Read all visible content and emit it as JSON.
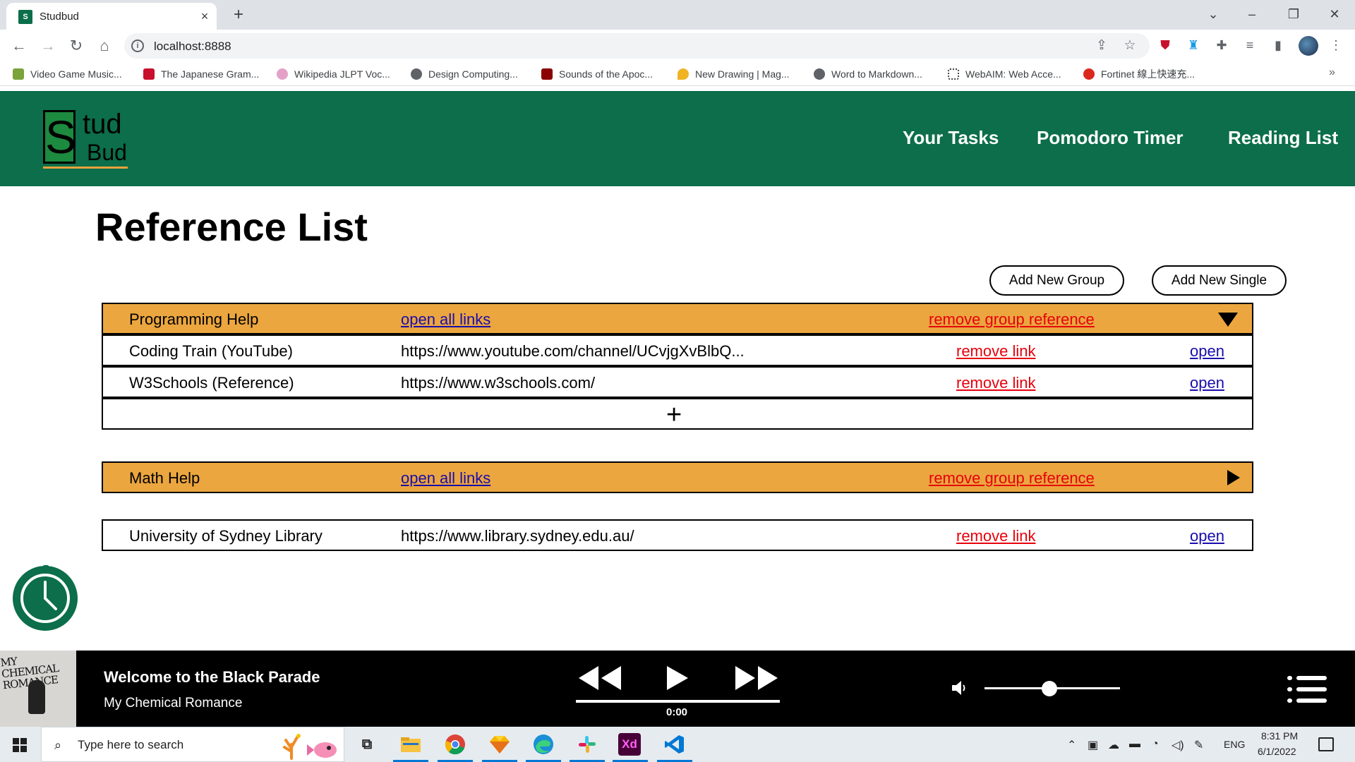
{
  "browser": {
    "tab_title": "Studbud",
    "tab_close_icon": "×",
    "new_tab_icon": "+",
    "url": "localhost:8888",
    "bookmarks": [
      {
        "label": "Video Game Music...",
        "color": "#7aa33a"
      },
      {
        "label": "The Japanese Gram...",
        "color": "#c8102e"
      },
      {
        "label": "Wikipedia JLPT Voc...",
        "color": "#e4a1c8"
      },
      {
        "label": "Design Computing...",
        "color": "#5f6368"
      },
      {
        "label": "Sounds of the Apoc...",
        "color": "#8b0000"
      },
      {
        "label": "New Drawing | Mag...",
        "color": "#f0b323"
      },
      {
        "label": "Word to Markdown...",
        "color": "#5f6368"
      },
      {
        "label": "WebAIM: Web Acce...",
        "color": "#444444"
      },
      {
        "label": "Fortinet 線上快速充...",
        "color": "#da291c"
      }
    ],
    "bookmarks_more": "»"
  },
  "site": {
    "logo": {
      "s": "S",
      "tud": "tud",
      "bud": "Bud"
    },
    "nav": [
      "Your Tasks",
      "Pomodoro Timer",
      "Reading List"
    ],
    "colors": {
      "header": "#0c6e4b",
      "group_row": "#eba63f",
      "remove": "#e8000b",
      "link": "#1a0dab"
    }
  },
  "main": {
    "title": "Reference List",
    "add_group_label": "Add New Group",
    "add_single_label": "Add New Single",
    "groups": [
      {
        "name": "Programming Help",
        "open_all": "open all links",
        "remove_group": "remove group reference",
        "expanded": true,
        "items": [
          {
            "name": "Coding Train (YouTube)",
            "url": "https://www.youtube.com/channel/UCvjgXvBlbQ...",
            "remove": "remove link",
            "open": "open"
          },
          {
            "name": "W3Schools (Reference)",
            "url": "https://www.w3schools.com/",
            "remove": "remove link",
            "open": "open"
          }
        ],
        "add_icon": "+"
      },
      {
        "name": "Math Help",
        "open_all": "open all links",
        "remove_group": "remove group reference",
        "expanded": false
      }
    ],
    "singles": [
      {
        "name": "University of Sydney Library",
        "url": "https://www.library.sydney.edu.au/",
        "remove": "remove link",
        "open": "open"
      }
    ]
  },
  "player": {
    "album_text": "MY CHEMICAL ROMANCE",
    "song": "Welcome to the Black Parade",
    "artist": "My Chemical Romance",
    "rewind_icon": "◀◀",
    "play_icon": "▶",
    "forward_icon": "▶▶",
    "time": "0:00",
    "volume_fraction": 0.48
  },
  "taskbar": {
    "search_placeholder": "Type here to search",
    "language": "ENG",
    "time": "8:31 PM",
    "date": "6/1/2022",
    "apps": [
      "task-view",
      "file-explorer",
      "chrome",
      "sketch",
      "edge",
      "slack",
      "adobe-xd",
      "vscode"
    ],
    "xd_label": "Xd"
  }
}
